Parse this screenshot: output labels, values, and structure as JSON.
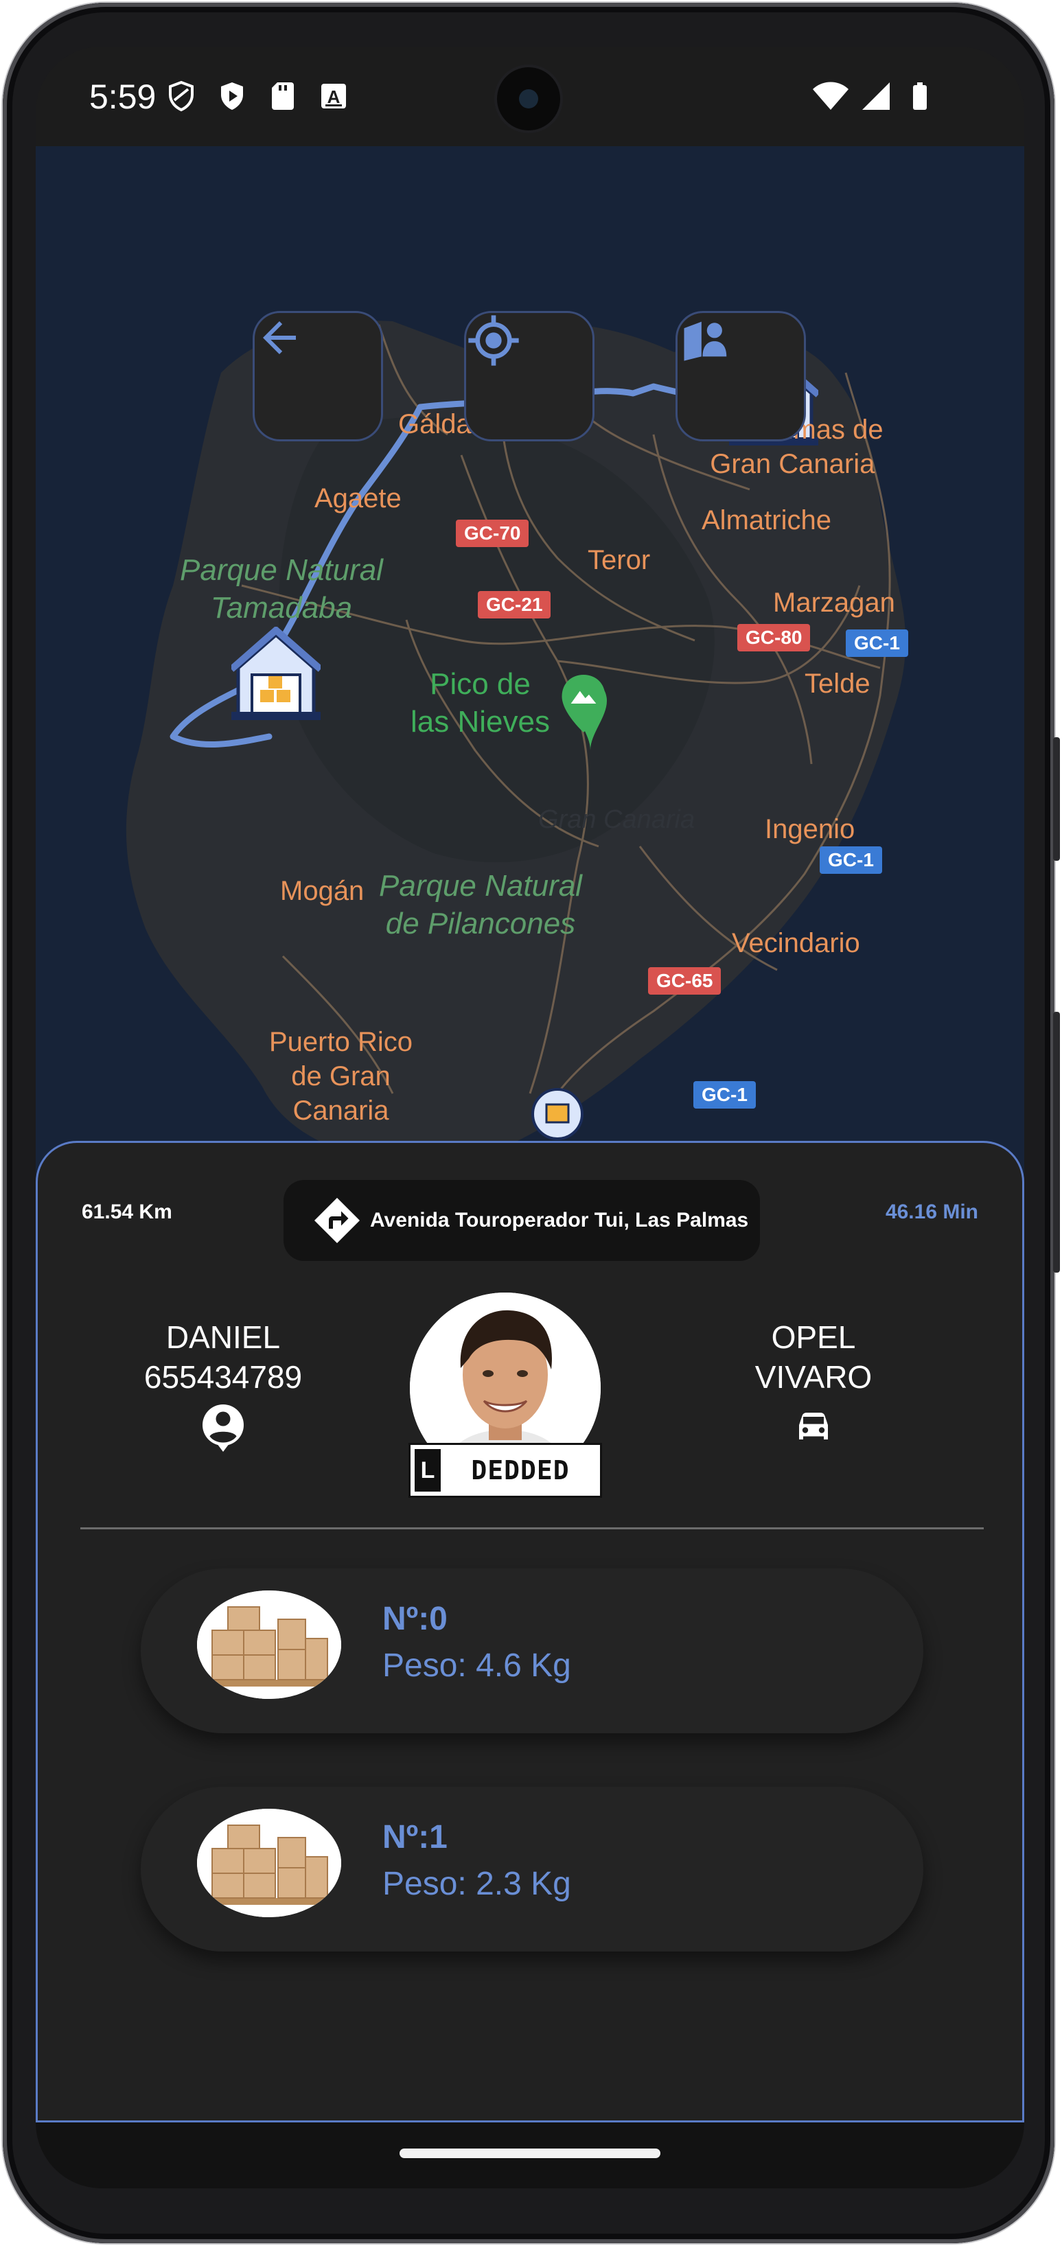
{
  "status_bar": {
    "time": "5:59",
    "icons": [
      "shield-outline-icon",
      "shield-play-icon",
      "sd-card-icon",
      "a-badge-icon",
      "wifi-icon",
      "signal-icon",
      "battery-icon"
    ]
  },
  "map": {
    "buttons": [
      {
        "icon": "arrow-back-icon"
      },
      {
        "icon": "my-location-icon"
      },
      {
        "icon": "profile-person-icon"
      }
    ],
    "places": {
      "galdar": "Gáldar",
      "agaete": "Agaete",
      "las_palmas": "Las Palmas de\nGran Canaria",
      "almatriche": "Almatriche",
      "teror": "Teror",
      "marzagan": "Marzagan",
      "telde": "Telde",
      "ingenio": "Ingenio",
      "mogan": "Mogán",
      "vecindario": "Vecindario",
      "puerto_rico": "Puerto Rico\nde Gran\nCanaria"
    },
    "parks": {
      "tamadaba": "Parque Natural\nTamadaba",
      "pilancones": "Parque Natural\nde Pilancones"
    },
    "peak": "Pico de\nlas Nieves",
    "island": "Gran Canaria",
    "roads": {
      "gc70": "GC-70",
      "gc21": "GC-21",
      "gc80": "GC-80",
      "gc1_a": "GC-1",
      "gc1_b": "GC-1",
      "gc65": "GC-65",
      "gc1_c": "GC-1"
    },
    "colors": {
      "route": "#6a8fd6",
      "background": "#172338"
    }
  },
  "trip": {
    "distance": "61.54 Km",
    "address": "Avenida Touroperador Tui, Las Palmas",
    "duration": "46.16 Min"
  },
  "driver": {
    "name": "DANIEL",
    "phone": "655434789",
    "icon": "account-circle-icon"
  },
  "vehicle": {
    "make": "OPEL",
    "model": "VIVARO",
    "icon": "car-icon"
  },
  "plate": {
    "prefix": "L",
    "number": "DEDDED"
  },
  "packages": [
    {
      "number": "Nº:0",
      "weight": "Peso: 4.6 Kg"
    },
    {
      "number": "Nº:1",
      "weight": "Peso: 2.3 Kg"
    }
  ],
  "accent_color": "#6a8fd6"
}
